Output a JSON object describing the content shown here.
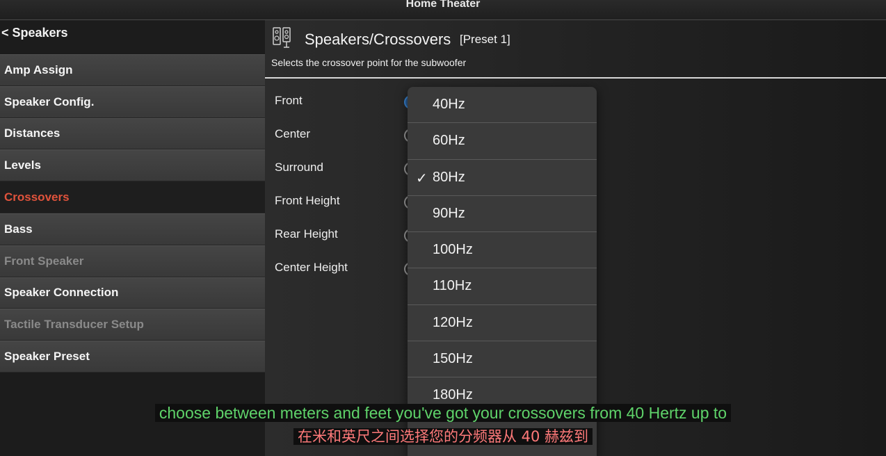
{
  "window": {
    "title": "Home Theater"
  },
  "sidebar": {
    "back_label": "< Speakers",
    "items": [
      {
        "label": "Amp Assign",
        "state": "normal"
      },
      {
        "label": "Speaker Config.",
        "state": "normal"
      },
      {
        "label": "Distances",
        "state": "normal"
      },
      {
        "label": "Levels",
        "state": "normal"
      },
      {
        "label": "Crossovers",
        "state": "active"
      },
      {
        "label": "Bass",
        "state": "normal"
      },
      {
        "label": "Front Speaker",
        "state": "disabled"
      },
      {
        "label": "Speaker Connection",
        "state": "normal"
      },
      {
        "label": "Tactile Transducer Setup",
        "state": "disabled"
      },
      {
        "label": "Speaker Preset",
        "state": "normal"
      }
    ]
  },
  "main": {
    "title": "Speakers/Crossovers",
    "preset": "[Preset 1]",
    "description": "Selects the crossover point for the subwoofer",
    "rows": [
      {
        "label": "Front"
      },
      {
        "label": "Center"
      },
      {
        "label": "Surround"
      },
      {
        "label": "Front Height"
      },
      {
        "label": "Rear Height"
      },
      {
        "label": "Center Height"
      }
    ]
  },
  "dropdown": {
    "selected": "80Hz",
    "options": [
      "40Hz",
      "60Hz",
      "80Hz",
      "90Hz",
      "100Hz",
      "110Hz",
      "120Hz",
      "150Hz",
      "180Hz"
    ]
  },
  "subtitles": {
    "english": "choose between meters and feet you've got your crossovers from 40 Hertz up to",
    "chinese": "在米和英尺之间选择您的分频器从 40 赫兹到"
  },
  "colors": {
    "active_menu": "#e0533c",
    "selector_accent": "#3a86d6",
    "subtitle_english": "#5fd36a",
    "subtitle_chinese": "#ff7a7a"
  },
  "icons": {
    "header": "speakers-icon",
    "selected_option": "checkmark-icon"
  }
}
